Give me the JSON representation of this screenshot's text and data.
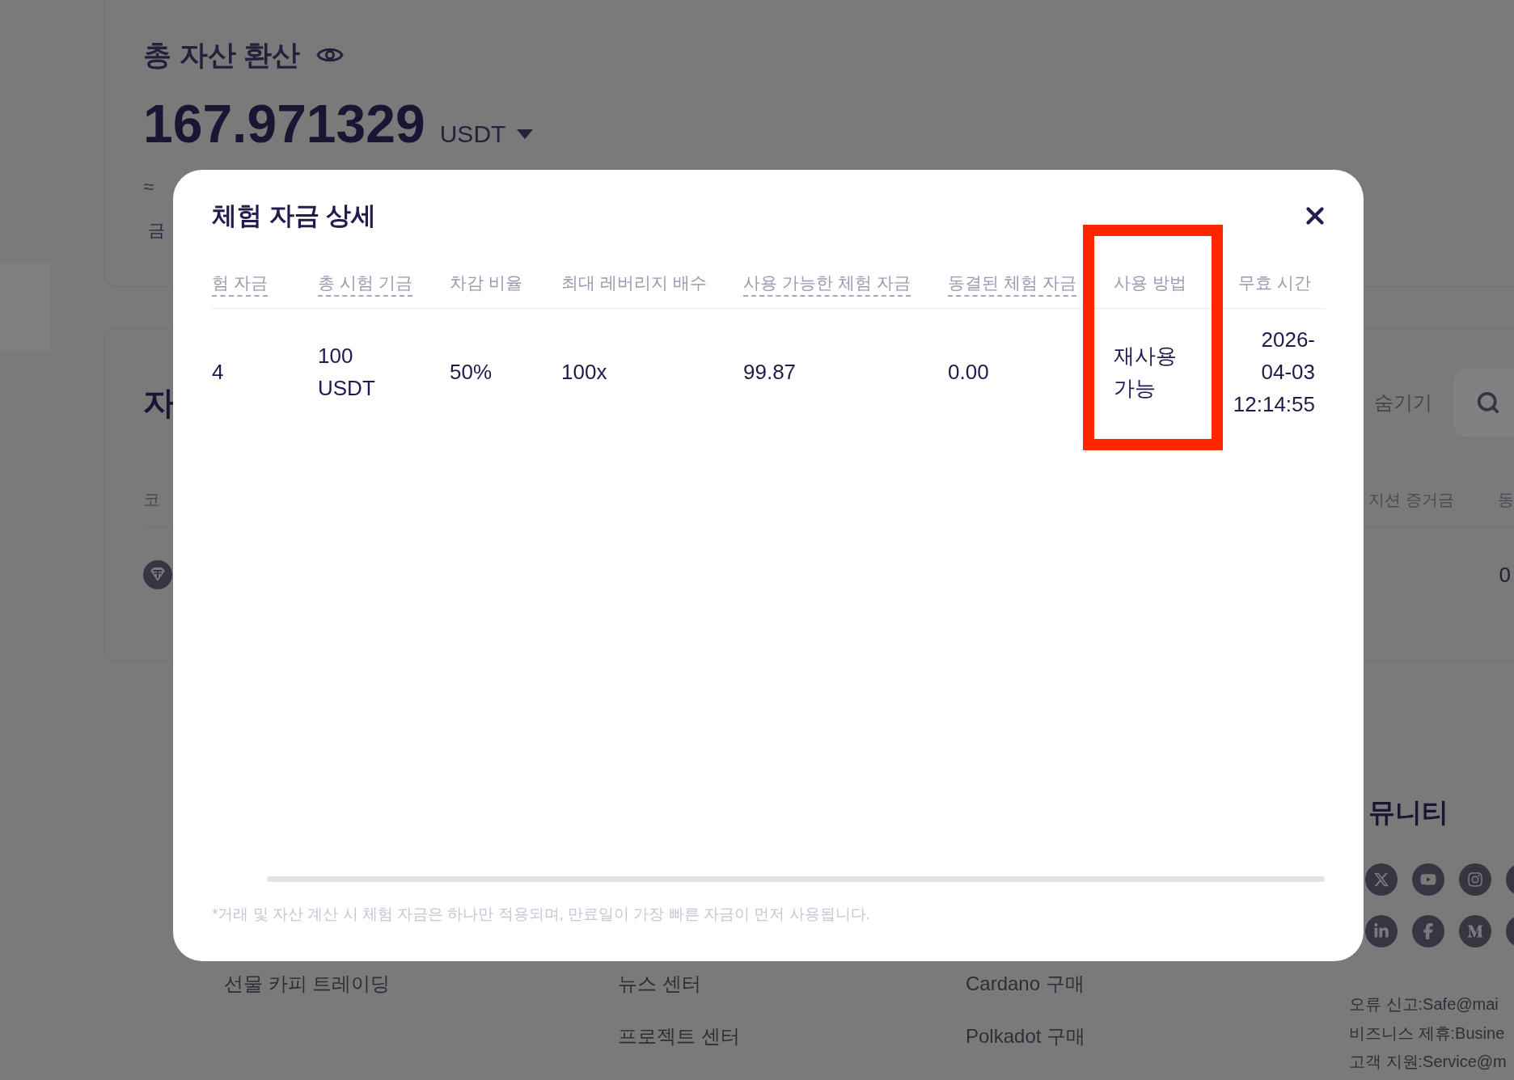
{
  "background": {
    "asset_summary": {
      "title": "총 자산 환산",
      "total": "167.971329",
      "currency": "USDT",
      "approx_value": "≈",
      "sub_label": "금"
    },
    "assets_panel": {
      "title": "자",
      "hide_label": "숨기기",
      "columns": [
        "코",
        "지션 증거금",
        "동"
      ],
      "rows": [
        {
          "value": "0"
        }
      ]
    },
    "footer": {
      "link_columns": [
        {
          "links": [
            "선물 카피 트레이딩"
          ]
        },
        {
          "links": [
            "뉴스 센터",
            "프로젝트 센터"
          ]
        },
        {
          "links": [
            "Cardano 구매",
            "Polkadot 구매"
          ]
        }
      ],
      "community_title": "뮤니티",
      "contacts": [
        "오류 신고:Safe@mai",
        "비즈니스 제휴:Busine",
        "고객 지원:Service@m"
      ]
    }
  },
  "modal": {
    "title": "체험 자금 상세",
    "columns": [
      {
        "label": "험 자금",
        "underlined": true,
        "highlighted": false
      },
      {
        "label": "총 시험 기금",
        "underlined": true,
        "highlighted": false
      },
      {
        "label": "차감 비율",
        "underlined": false,
        "highlighted": false
      },
      {
        "label": "최대 레버리지 배수",
        "underlined": false,
        "highlighted": false
      },
      {
        "label": "사용 가능한 체험 자금",
        "underlined": true,
        "highlighted": false
      },
      {
        "label": "동결된 체험 자금",
        "underlined": true,
        "highlighted": false
      },
      {
        "label": "사용 방법",
        "underlined": false,
        "highlighted": true
      },
      {
        "label": "무효 시간",
        "underlined": false,
        "highlighted": false
      }
    ],
    "rows": [
      {
        "cells": [
          "4",
          "100 USDT",
          "50%",
          "100x",
          "99.87",
          "0.00",
          "재사용 가능",
          "2026-04-03 12:14:55"
        ]
      }
    ],
    "note": "*거래 및 자산 계산 시 체험 자금은 하나만 적용되며, 만료일이 가장 빠른 자금이 먼저 사용됩니다."
  }
}
